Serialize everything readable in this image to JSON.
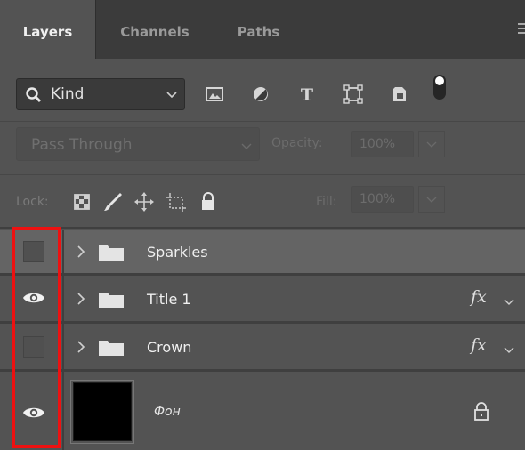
{
  "tabs": [
    {
      "label": "Layers",
      "active": true
    },
    {
      "label": "Channels",
      "active": false
    },
    {
      "label": "Paths",
      "active": false
    }
  ],
  "filter": {
    "kind_label": "Kind",
    "icons": [
      "pixel-layer-filter-icon",
      "adjustment-layer-filter-icon",
      "type-layer-filter-icon",
      "shape-layer-filter-icon",
      "smart-object-filter-icon",
      "filter-toggle-icon"
    ]
  },
  "blend": {
    "mode": "Pass Through",
    "opacity_label": "Opacity:",
    "opacity_value": "100%"
  },
  "lock": {
    "label": "Lock:",
    "icons": [
      "lock-transparent-pixels-icon",
      "lock-image-pixels-icon",
      "lock-position-icon",
      "lock-artboard-icon",
      "lock-all-icon"
    ],
    "fill_label": "Fill:",
    "fill_value": "100%"
  },
  "layers": [
    {
      "name": "Sparkles",
      "type": "group",
      "visible": false,
      "selected": true,
      "fx": false
    },
    {
      "name": "Title 1",
      "type": "group",
      "visible": true,
      "selected": false,
      "fx": true
    },
    {
      "name": "Crown",
      "type": "group",
      "visible": false,
      "selected": false,
      "fx": true
    },
    {
      "name": "Фон",
      "type": "background",
      "visible": true,
      "selected": false,
      "locked": true
    }
  ],
  "fx_label": "fx",
  "colors": {
    "panel_bg": "#535353",
    "selected_row": "#646464",
    "highlight": "#ee1111",
    "tab_bar": "#3b3b3b"
  }
}
